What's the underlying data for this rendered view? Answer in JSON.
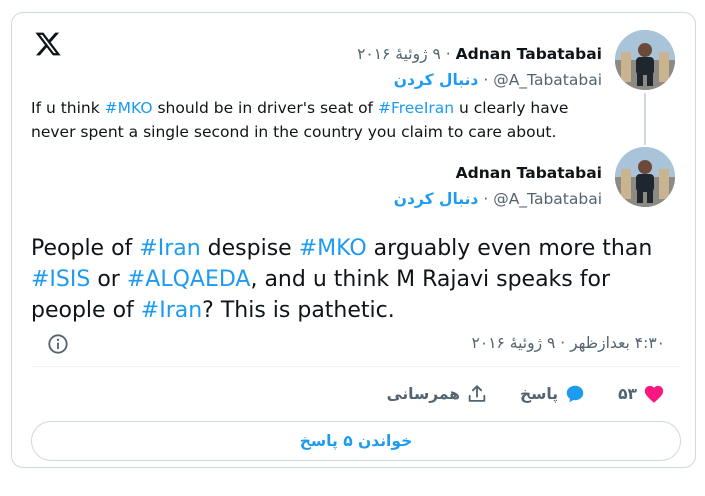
{
  "quoted_tweet": {
    "author_name": "Adnan Tabatabai",
    "handle": "@A_Tabatabai",
    "date": "۹ ژوئیهٔ ۲۰۱۶",
    "follow_label": "دنبال کردن",
    "text_parts": [
      {
        "t": "If u think ",
        "tag": false
      },
      {
        "t": "#MKO",
        "tag": true
      },
      {
        "t": " should be in driver's seat of ",
        "tag": false
      },
      {
        "t": "#FreeIran",
        "tag": true
      },
      {
        "t": " u clearly have never spent a single second in the country you claim to care about.",
        "tag": false
      }
    ]
  },
  "main_tweet": {
    "author_name": "Adnan Tabatabai",
    "handle": "@A_Tabatabai",
    "follow_label": "دنبال کردن",
    "text_parts": [
      {
        "t": "People of ",
        "tag": false
      },
      {
        "t": "#Iran",
        "tag": true
      },
      {
        "t": " despise ",
        "tag": false
      },
      {
        "t": "#MKO",
        "tag": true
      },
      {
        "t": " arguably even more than ",
        "tag": false
      },
      {
        "t": "#ISIS",
        "tag": true
      },
      {
        "t": " or ",
        "tag": false
      },
      {
        "t": "#ALQAEDA",
        "tag": true
      },
      {
        "t": ", and u think M Rajavi speaks for people of ",
        "tag": false
      },
      {
        "t": "#Iran",
        "tag": true
      },
      {
        "t": "? This is pathetic.",
        "tag": false
      }
    ],
    "timestamp": "۴:۳۰ بعدازظهر · ۹ ژوئیهٔ ۲۰۱۶"
  },
  "actions": {
    "like_count": "۵۳",
    "reply_label": "پاسخ",
    "share_label": "همرسانی"
  },
  "read_replies_label": "خواندن ۵ پاسخ",
  "separator": "·",
  "colors": {
    "accent": "#1d9bf0",
    "like": "#f91880",
    "muted": "#536471"
  },
  "icons": [
    "x-logo-icon",
    "info-icon",
    "heart-icon",
    "reply-bubble-icon",
    "share-icon"
  ]
}
